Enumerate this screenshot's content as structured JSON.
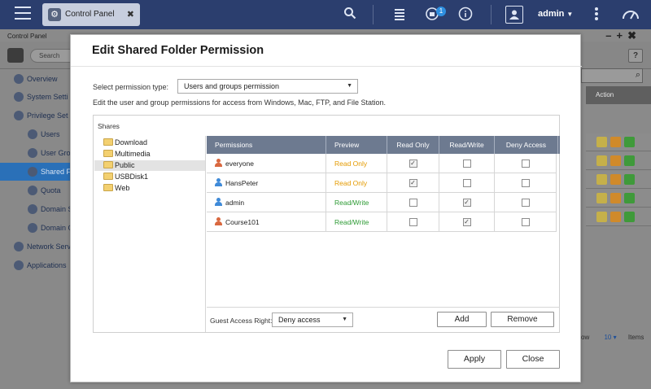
{
  "topbar": {
    "tab_label": "Control Panel",
    "tab_close": "✖",
    "notification_count": "1",
    "username": "admin"
  },
  "control_panel": {
    "title": "Control Panel",
    "window_controls": "–+✖",
    "search_placeholder": "Search",
    "help": "?",
    "sidebar": [
      {
        "label": "Overview",
        "icon": "grid-icon"
      },
      {
        "label": "System Setti",
        "icon": "gear-icon"
      },
      {
        "label": "Privilege Set",
        "icon": "users-icon"
      },
      {
        "label": "Users",
        "icon": "user-icon"
      },
      {
        "label": "User Gro",
        "icon": "user-group-icon"
      },
      {
        "label": "Shared F",
        "icon": "shared-folder-icon",
        "selected": true
      },
      {
        "label": "Quota",
        "icon": "quota-icon"
      },
      {
        "label": "Domain S",
        "icon": "domain-security-icon"
      },
      {
        "label": "Domain C",
        "icon": "domain-controller-icon"
      },
      {
        "label": "Network Serv",
        "icon": "network-icon"
      },
      {
        "label": "Applications",
        "icon": "applications-icon"
      }
    ],
    "action_header": "Action",
    "footer_show": "ow",
    "footer_count": "10",
    "footer_items": "Items"
  },
  "dialog": {
    "title": "Edit Shared Folder Permission",
    "permission_type_label": "Select permission type:",
    "permission_type_value": "Users and groups permission",
    "description": "Edit the user and group permissions for access from Windows, Mac, FTP, and File Station.",
    "shares_label": "Shares",
    "folders": [
      "Download",
      "Multimedia",
      "Public",
      "USBDisk1",
      "Web"
    ],
    "selected_folder": "Public",
    "columns": [
      "Permissions",
      "Preview",
      "Read Only",
      "Read/Write",
      "Deny Access"
    ],
    "rows": [
      {
        "name": "everyone",
        "type": "group",
        "preview": "Read Only",
        "read_only": true,
        "read_write": false,
        "deny": false
      },
      {
        "name": "HansPeter",
        "type": "user",
        "preview": "Read Only",
        "read_only": true,
        "read_write": false,
        "deny": false
      },
      {
        "name": "admin",
        "type": "user",
        "preview": "Read/Write",
        "read_only": false,
        "read_write": true,
        "deny": false
      },
      {
        "name": "Course101",
        "type": "group",
        "preview": "Read/Write",
        "read_only": false,
        "read_write": true,
        "deny": false
      }
    ],
    "guest_access_label": "Guest Access Right:",
    "guest_access_value": "Deny access",
    "add_label": "Add",
    "remove_label": "Remove",
    "apply_label": "Apply",
    "close_label": "Close"
  },
  "colors": {
    "topbar": "#2b3e6e",
    "table_header": "#6d7a90",
    "read_only": "#e49a00",
    "read_write": "#2c9a33",
    "user_icon": "#3f8ad8",
    "group_icon": "#d9683f"
  }
}
